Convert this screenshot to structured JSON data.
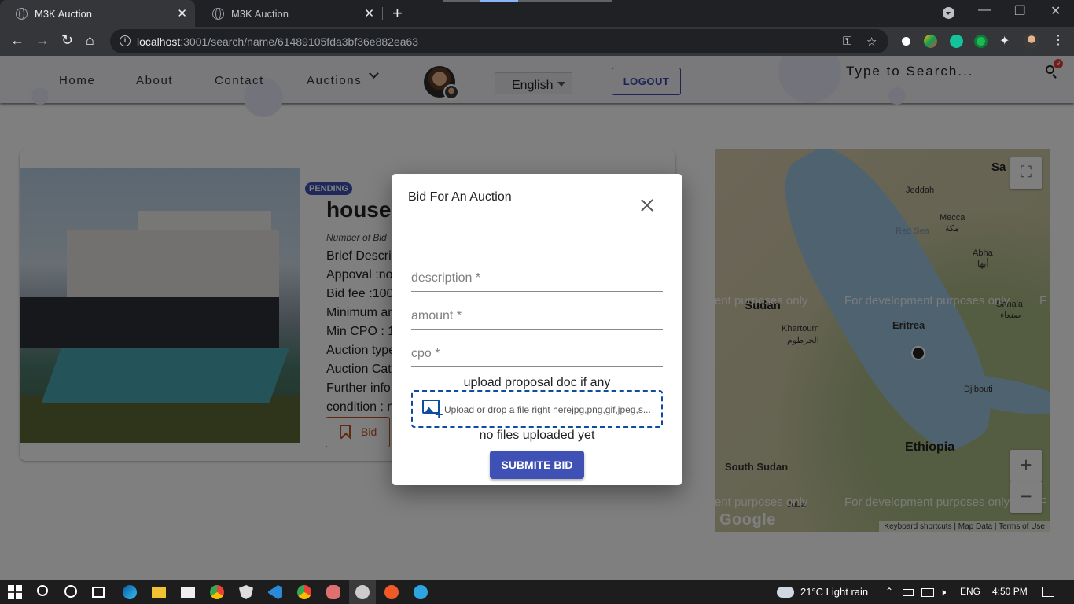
{
  "browser": {
    "tabs": [
      {
        "title": "M3K Auction",
        "active": true
      },
      {
        "title": "M3K Auction",
        "active": false
      }
    ],
    "url_host": "localhost",
    "url_rest": ":3001/search/name/61489105fda3bf36e882ea63"
  },
  "nav": {
    "home": "Home",
    "about": "About",
    "contact": "Contact",
    "auctions": "Auctions",
    "language": "English",
    "logout": "LOGOUT",
    "search_placeholder": "Type to Search...",
    "notification_count": "9"
  },
  "auction": {
    "status": "PENDING",
    "title": "house",
    "bids_line": "Number of Bid",
    "lines": [
      "Brief Descrip",
      "Appoval :no",
      "Bid fee :100",
      "Minimum am",
      "Min CPO : 1",
      "Auction type",
      "Auction Cate",
      "Further info",
      "condition : n"
    ],
    "bid_button": "Bid"
  },
  "map": {
    "labels": {
      "jeddah": "Jeddah",
      "mecca": "Mecca",
      "mecca_ar": "مكة",
      "red_sea": "Red Sea",
      "abha": "Abha",
      "abha_ar": "أبها",
      "sudan": "Sudan",
      "khartoum": "Khartoum",
      "khartoum_ar": "الخرطوم",
      "eritrea": "Eritrea",
      "sanaa": "Sana'a",
      "sanaa_ar": "صنعاء",
      "djibouti": "Djibouti",
      "ethiopia": "Ethiopia",
      "south_sudan": "South Sudan",
      "juba": "Juba",
      "saudi": "Sa"
    },
    "watermark": "For development purposes only",
    "watermark_left": "ent purposes only",
    "watermark_right": "F",
    "google": "Google",
    "footer": [
      "Keyboard shortcuts",
      "Map Data",
      "Terms of Use"
    ]
  },
  "modal": {
    "title": "Bid For An Auction",
    "description_label": "description *",
    "amount_label": "amount *",
    "cpo_label": "cpo *",
    "upload_label": "upload proposal doc if any",
    "dropzone_link": "Upload",
    "dropzone_text": " or drop a file right herejpg,png,gif,jpeg,s...",
    "no_files": "no files uploaded yet",
    "submit": "SUBMITE BID"
  },
  "taskbar": {
    "weather": "21°C  Light rain",
    "lang": "ENG",
    "time": "4:50 PM"
  }
}
